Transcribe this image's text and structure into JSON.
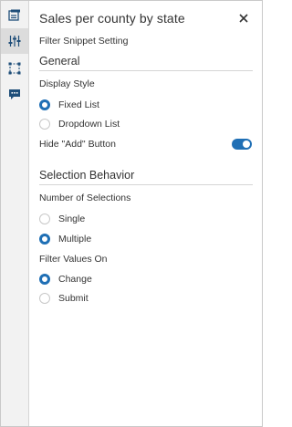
{
  "panel": {
    "title": "Sales per county by state",
    "subtitle": "Filter Snippet Setting"
  },
  "rail": {
    "icons": [
      "report-snippet-icon",
      "sliders-icon",
      "selection-box-icon",
      "comment-icon"
    ],
    "active_index": 1
  },
  "general": {
    "heading": "General",
    "display_style_label": "Display Style",
    "display_style_options": [
      "Fixed List",
      "Dropdown List"
    ],
    "display_style_selected": "Fixed List",
    "hide_add_label": "Hide \"Add\" Button",
    "hide_add_on": true
  },
  "selection": {
    "heading": "Selection Behavior",
    "number_label": "Number of Selections",
    "number_options": [
      "Single",
      "Multiple"
    ],
    "number_selected": "Multiple",
    "filter_label": "Filter Values On",
    "filter_options": [
      "Change",
      "Submit"
    ],
    "filter_selected": "Change"
  },
  "colors": {
    "accent": "#1f6fb5",
    "rail_bg": "#f2f2f2",
    "rail_active": "#dcdcdc"
  }
}
